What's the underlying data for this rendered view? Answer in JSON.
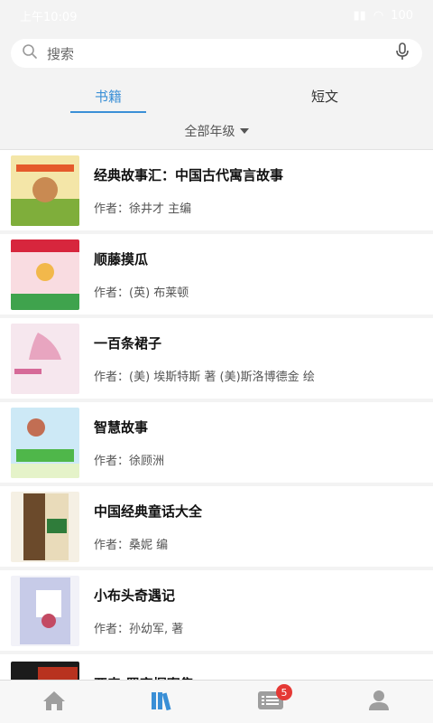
{
  "statusbar": {
    "time": "上午10:09",
    "battery": "100"
  },
  "search": {
    "placeholder": "搜索"
  },
  "tabs": [
    {
      "label": "书籍",
      "active": true
    },
    {
      "label": "短文",
      "active": false
    }
  ],
  "filter": {
    "grade_label": "全部年级"
  },
  "books": [
    {
      "title": "经典故事汇：中国古代寓言故事",
      "author": "作者：徐井才 主编",
      "cover_color": "#f4e6a8"
    },
    {
      "title": "顺藤摸瓜",
      "author": "作者：(英) 布莱顿",
      "cover_color": "#f9dce1"
    },
    {
      "title": "一百条裙子",
      "author": "作者：(美) 埃斯特斯 著 (美)斯洛博德金 绘",
      "cover_color": "#f6e7ee"
    },
    {
      "title": "智慧故事",
      "author": "作者：徐顾洲",
      "cover_color": "#cde9f6"
    },
    {
      "title": "中国经典童话大全",
      "author": "作者：桑妮 编",
      "cover_color": "#e9dbba"
    },
    {
      "title": "小布头奇遇记",
      "author": "作者：孙幼军, 著",
      "cover_color": "#c7cbe8"
    },
    {
      "title": "亚森·罗宾探案集",
      "author": "",
      "cover_color": "#1b1b1b"
    }
  ],
  "nav": {
    "items": [
      {
        "name": "home-icon"
      },
      {
        "name": "bookshelf-icon"
      },
      {
        "name": "list-icon"
      },
      {
        "name": "user-icon"
      }
    ],
    "badge": "5",
    "accent": "#3a8fd6",
    "inactive_color": "#9e9e9e"
  }
}
